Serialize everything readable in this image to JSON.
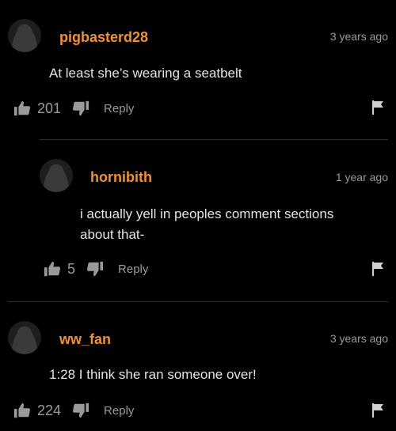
{
  "comments": [
    {
      "username": "pigbasterd28",
      "time": "3 years ago",
      "text": "At least she’s wearing a seatbelt",
      "likes": "201",
      "reply_label": "Reply"
    },
    {
      "username": "hornibith",
      "time": "1 year ago",
      "text": "i actually yell in peoples comment sections\nabout that-",
      "likes": "5",
      "reply_label": "Reply"
    },
    {
      "username": "ww_fan",
      "time": "3 years ago",
      "text": "1:28 I think she ran someone over!",
      "likes": "224",
      "reply_label": "Reply"
    }
  ],
  "colors": {
    "background": "#000000",
    "username": "#f0913a",
    "meta": "#9a9a9a",
    "text": "#e4e4e4"
  },
  "icons": {
    "like": "thumbs-up-icon",
    "dislike": "thumbs-down-icon",
    "flag": "flag-icon",
    "avatar": "default-avatar"
  }
}
